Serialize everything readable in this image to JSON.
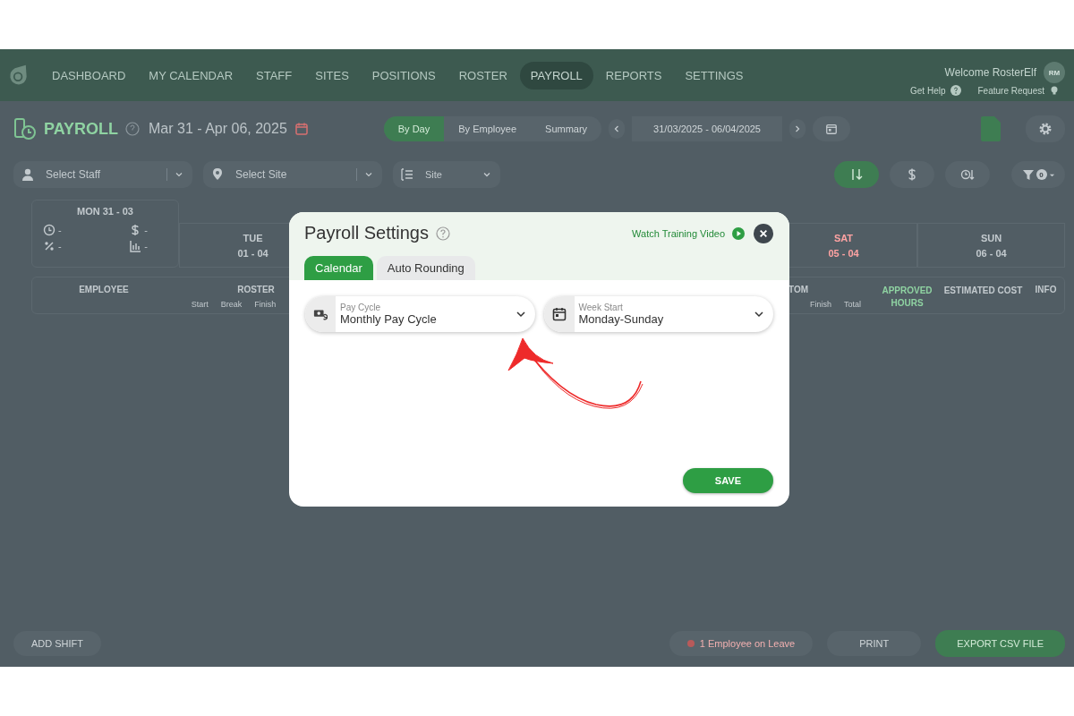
{
  "nav": {
    "items": [
      {
        "label": "DASHBOARD",
        "selected": false
      },
      {
        "label": "MY CALENDAR",
        "selected": false
      },
      {
        "label": "STAFF",
        "selected": false
      },
      {
        "label": "SITES",
        "selected": false
      },
      {
        "label": "POSITIONS",
        "selected": false
      },
      {
        "label": "ROSTER",
        "selected": false
      },
      {
        "label": "PAYROLL",
        "selected": true
      },
      {
        "label": "REPORTS",
        "selected": false
      },
      {
        "label": "SETTINGS",
        "selected": false
      }
    ],
    "welcome": "Welcome RosterElf",
    "avatar": "RM",
    "help": "Get Help",
    "feature": "Feature Request"
  },
  "toolbar": {
    "title": "PAYROLL",
    "date_range": "Mar 31 - Apr 06, 2025",
    "views": [
      {
        "label": "By Day",
        "selected": true
      },
      {
        "label": "By Employee",
        "selected": false
      },
      {
        "label": "Summary",
        "selected": false
      }
    ],
    "date_field": "31/03/2025 - 06/04/2025"
  },
  "filters": {
    "staff_placeholder": "Select Staff",
    "site_placeholder": "Select Site",
    "group_value": "Site",
    "filter_count": "0"
  },
  "summary": {
    "day": "MON 31 - 03",
    "stats": [
      {
        "kind": "hours",
        "value": "-"
      },
      {
        "kind": "cost",
        "value": "-"
      },
      {
        "kind": "percent",
        "value": "-"
      },
      {
        "kind": "chart",
        "value": "-"
      }
    ]
  },
  "days": [
    {
      "name": "TUE",
      "date": "01 - 04",
      "color": "#c3cace"
    },
    {
      "name": "SAT",
      "date": "05 - 04",
      "color": "#ffa3a3"
    },
    {
      "name": "SUN",
      "date": "06 - 04",
      "color": "#c3cace"
    }
  ],
  "table": {
    "employee": "EMPLOYEE",
    "roster": "ROSTER",
    "roster_sub": [
      "Start",
      "Break",
      "Finish"
    ],
    "custom": "TOM",
    "custom_sub": [
      "Finish",
      "Total"
    ],
    "approved": "APPROVED HOURS",
    "estimated": "ESTIMATED COST",
    "info": "INFO"
  },
  "footer": {
    "add": "ADD SHIFT",
    "leave": "1 Employee on Leave",
    "print": "PRINT",
    "export": "EXPORT CSV FILE"
  },
  "modal": {
    "title": "Payroll Settings",
    "video": "Watch Training Video",
    "tabs": [
      {
        "label": "Calendar",
        "selected": true
      },
      {
        "label": "Auto Rounding",
        "selected": false
      }
    ],
    "fields": [
      {
        "kind": "pay",
        "label": "Pay Cycle",
        "value": "Monthly Pay Cycle"
      },
      {
        "kind": "calendar",
        "label": "Week Start",
        "value": "Monday-Sunday"
      }
    ],
    "save": "SAVE"
  }
}
